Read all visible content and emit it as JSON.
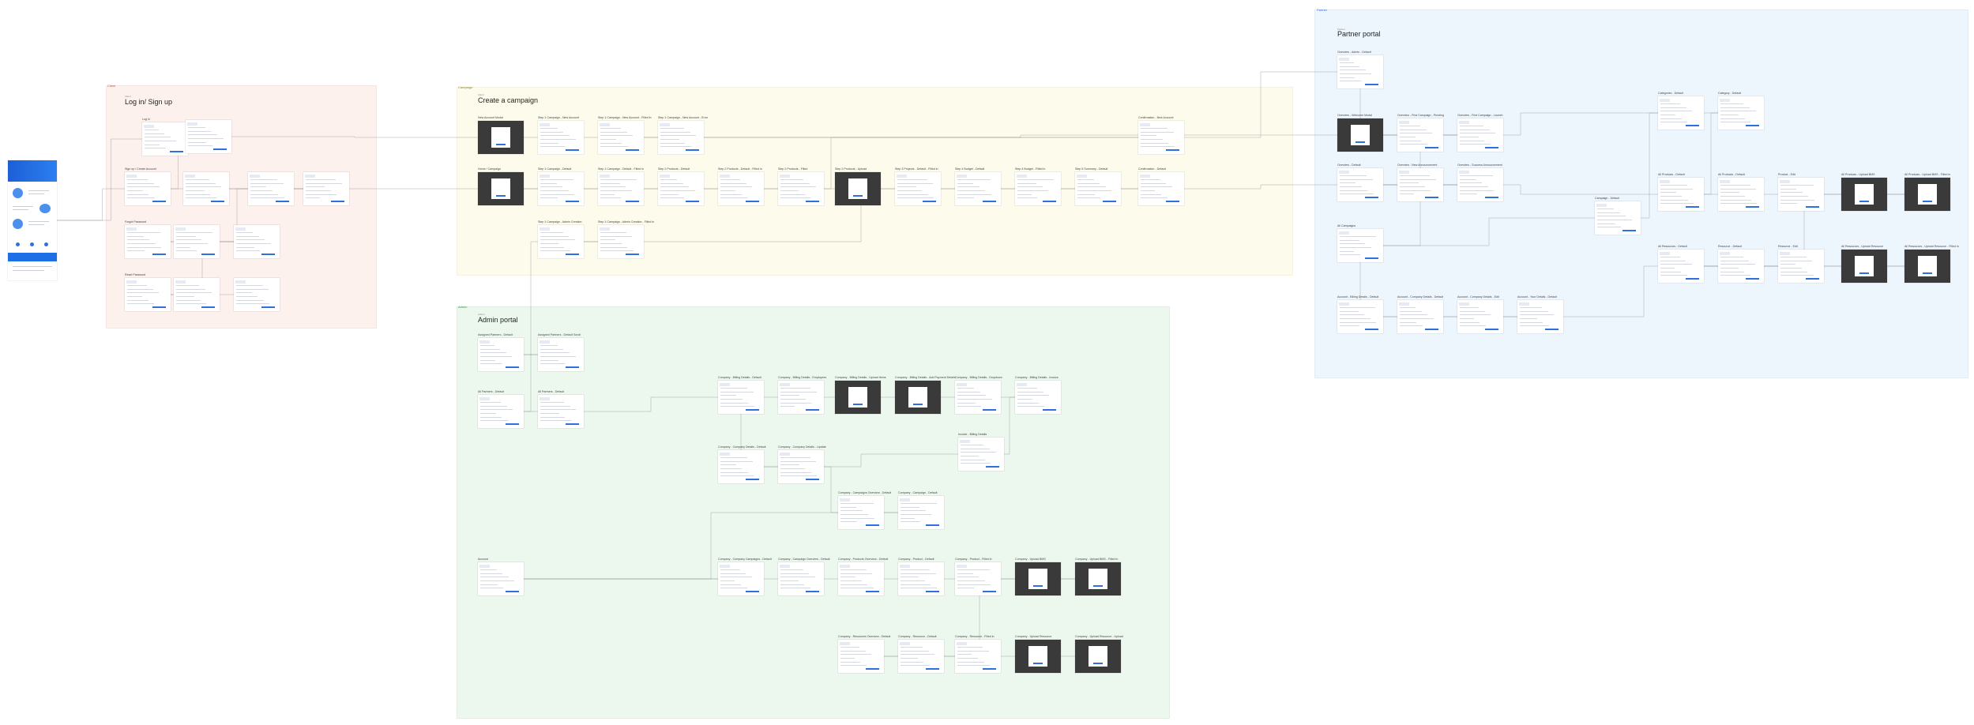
{
  "colors": {
    "login_section": "#fdf1ee",
    "campaign_section": "#fdfbec",
    "admin_section": "#ecf8ee",
    "partner_section": "#eef6fd",
    "accent": "#2f6fde",
    "connector": "#8a8a8a"
  },
  "sections": {
    "login": {
      "tag": "Client",
      "small": "Client",
      "title": "Log in/ Sign up"
    },
    "campaign": {
      "tag": "Campaign",
      "small": "Client",
      "title": "Create a campaign"
    },
    "admin": {
      "tag": "Admin",
      "small": "Admin",
      "title": "Admin portal"
    },
    "partner": {
      "tag": "Partner",
      "small": "Partner",
      "title": "Partner portal"
    }
  },
  "frames": {
    "login": [
      {
        "label": "Log in"
      },
      {
        "label": ""
      },
      {
        "label": "Sign up / Create Account"
      },
      {
        "label": ""
      },
      {
        "label": ""
      },
      {
        "label": ""
      },
      {
        "label": "Forgot Password"
      },
      {
        "label": ""
      },
      {
        "label": ""
      },
      {
        "label": "Reset Password"
      },
      {
        "label": ""
      },
      {
        "label": ""
      }
    ],
    "campaign": [
      {
        "label": "New Account Modal"
      },
      {
        "label": "Step 1 Campaign - New Account"
      },
      {
        "label": "Step 1 Campaign - New Account - Filled in"
      },
      {
        "label": "Step 1 Campaign - New Account - Error"
      },
      {
        "label": "Confirmation - New Account"
      },
      {
        "label": "Home / Campaign"
      },
      {
        "label": "Step 1 Campaign - Default"
      },
      {
        "label": "Step 1 Campaign - Default - Filled in"
      },
      {
        "label": "Step 2 Products - Default"
      },
      {
        "label": "Step 2 Products - Default - Filled in"
      },
      {
        "label": "Step 2 Products - Filled"
      },
      {
        "label": "Step 2 Products - Upload"
      },
      {
        "label": "Step 3 Projects - Default - Filled in"
      },
      {
        "label": "Step 4 Budget - Default"
      },
      {
        "label": "Step 4 Budget - Filled in"
      },
      {
        "label": "Step 5 Summary - Default"
      },
      {
        "label": "Confirmation - Default"
      },
      {
        "label": "Step 1 Campaign - Admin Creation"
      },
      {
        "label": "Step 1 Campaign - Admin Creation - Filled in"
      }
    ],
    "admin": [
      {
        "label": "Assigned Partners - Default"
      },
      {
        "label": "Assigned Partners - Default Scroll"
      },
      {
        "label": "All Partners - Default"
      },
      {
        "label": "All Partners - Default"
      },
      {
        "label": "Company - Billing Details - Default"
      },
      {
        "label": "Company - Billing Details - Employees"
      },
      {
        "label": "Company - Billing Details - Upload Items"
      },
      {
        "label": "Company - Billing Details - Add Payment Details"
      },
      {
        "label": "Company - Billing Details - Dropdown"
      },
      {
        "label": "Company - Billing Details - Invoice"
      },
      {
        "label": "Invoice - Billing Details"
      },
      {
        "label": "Company - Company Details - Default"
      },
      {
        "label": "Company - Company Details - Update"
      },
      {
        "label": "Company - Campaigns Overview - Default"
      },
      {
        "label": "Company - Campaign - Default"
      },
      {
        "label": "Account"
      },
      {
        "label": "Company - Company Campaigns - Default"
      },
      {
        "label": "Company - Campaign Overview - Default"
      },
      {
        "label": "Company - Products Overview - Default"
      },
      {
        "label": "Company - Product - Default"
      },
      {
        "label": "Company - Product - Filled in"
      },
      {
        "label": "Company - Upload BMS"
      },
      {
        "label": "Company - Upload BMS - Filled in"
      },
      {
        "label": "Company - Resources Overview - Default"
      },
      {
        "label": "Company - Resource - Default"
      },
      {
        "label": "Company - Resource - Filled in"
      },
      {
        "label": "Company - Upload Resource"
      },
      {
        "label": "Company - Upload Resource - Upload"
      }
    ],
    "partner": [
      {
        "label": "Overview - Admin - Default"
      },
      {
        "label": "Overview - Welcome Modal"
      },
      {
        "label": "Overview - First Campaign - Pending"
      },
      {
        "label": "Overview - First Campaign - Launch"
      },
      {
        "label": "Overview - Default"
      },
      {
        "label": "Overview - New Announcement"
      },
      {
        "label": "Overview - Success Announcement"
      },
      {
        "label": "All Campaigns"
      },
      {
        "label": "Campaign - Default"
      },
      {
        "label": "Categories - Default"
      },
      {
        "label": "Category - Default"
      },
      {
        "label": "All Products - Default"
      },
      {
        "label": "All Products - Default"
      },
      {
        "label": "Product - Edit"
      },
      {
        "label": "All Products - Upload BMS"
      },
      {
        "label": "All Products - Upload BMS - Filled in"
      },
      {
        "label": "All Resources - Default"
      },
      {
        "label": "Resource - Default"
      },
      {
        "label": "Resource - Edit"
      },
      {
        "label": "All Resources - Upload Resource"
      },
      {
        "label": "All Resources - Upload Resource - Filled in"
      },
      {
        "label": "Account - Billing Details - Default"
      },
      {
        "label": "Account - Company Details - Default"
      },
      {
        "label": "Account - Company Details - Edit"
      },
      {
        "label": "Account - Your Details - Default"
      }
    ]
  }
}
